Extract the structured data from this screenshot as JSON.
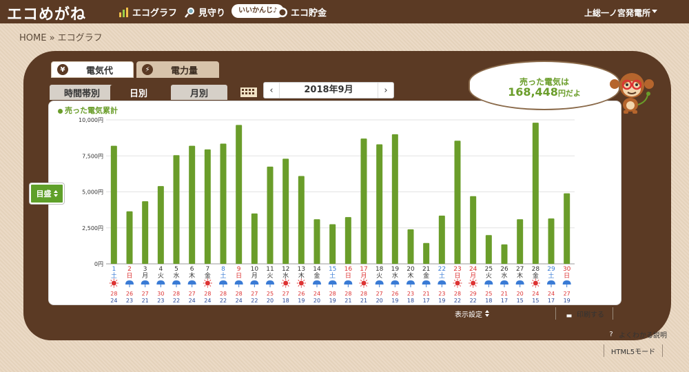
{
  "header": {
    "logo": "エコめがね",
    "nav": [
      {
        "label": "エコグラフ",
        "icon": "bar-chart-icon"
      },
      {
        "label": "見守り",
        "icon": "magnifier-icon"
      },
      {
        "label": "エコ貯金",
        "icon": "coin-icon"
      }
    ],
    "pill": "いいかんじ♪",
    "plant": "上総一ノ宮発電所"
  },
  "breadcrumb": "HOME » エコグラフ",
  "tabs": [
    {
      "label": "電気代",
      "icon": "yen-icon",
      "active": true
    },
    {
      "label": "電力量",
      "icon": "lightning-icon",
      "active": false
    }
  ],
  "subtabs": [
    {
      "label": "時間帯別",
      "active": false
    },
    {
      "label": "日別",
      "active": true
    },
    {
      "label": "月別",
      "active": false
    }
  ],
  "month_nav": {
    "prev": "‹",
    "label": "2018年9月",
    "next": "›"
  },
  "bubble": {
    "line1": "売った電気は",
    "amount": "168,448",
    "unit": "円だよ"
  },
  "target_button": "目盛",
  "footer": {
    "display_settings": "表示設定",
    "print": "印刷する",
    "help": "よくわかる説明",
    "html5": "HTML5モード"
  },
  "colors": {
    "accent_brown": "#5b3a24",
    "bar_green": "#6a9d2a",
    "saturday": "#3a7bd5",
    "holiday": "#d33",
    "high_temp": "#d33",
    "low_temp": "#2a4a9a"
  },
  "chart_data": {
    "type": "bar",
    "legend": "売った電気累計",
    "ylim": [
      0,
      10000
    ],
    "yticks": [
      "0円",
      "2,500円",
      "5,000円",
      "7,500円",
      "10,000円"
    ],
    "yvals": [
      0,
      2500,
      5000,
      7500,
      10000
    ],
    "categories": [
      "1",
      "2",
      "3",
      "4",
      "5",
      "6",
      "7",
      "8",
      "9",
      "10",
      "11",
      "12",
      "13",
      "14",
      "15",
      "16",
      "17",
      "18",
      "19",
      "20",
      "21",
      "22",
      "23",
      "24",
      "25",
      "26",
      "27",
      "28",
      "29",
      "30"
    ],
    "weekdays": [
      "土",
      "日",
      "月",
      "火",
      "水",
      "木",
      "金",
      "土",
      "日",
      "月",
      "火",
      "水",
      "木",
      "金",
      "土",
      "日",
      "月",
      "火",
      "水",
      "木",
      "金",
      "土",
      "日",
      "月",
      "火",
      "水",
      "木",
      "金",
      "土",
      "日"
    ],
    "day_kind": [
      "sat",
      "hol",
      "wk",
      "wk",
      "wk",
      "wk",
      "wk",
      "sat",
      "hol",
      "wk",
      "wk",
      "wk",
      "wk",
      "wk",
      "sat",
      "hol",
      "hol",
      "wk",
      "wk",
      "wk",
      "wk",
      "sat",
      "hol",
      "hol",
      "wk",
      "wk",
      "wk",
      "wk",
      "sat",
      "hol"
    ],
    "weather": [
      "sun",
      "rain",
      "rain",
      "rain",
      "rain",
      "rain",
      "sun",
      "rain",
      "rain",
      "rain",
      "rain",
      "sun",
      "sun",
      "rain",
      "rain",
      "rain",
      "sun",
      "rain",
      "rain",
      "rain",
      "rain",
      "rain",
      "sun",
      "sun",
      "rain",
      "rain",
      "rain",
      "sun",
      "rain",
      "rain"
    ],
    "high_temp": [
      "28",
      "26",
      "27",
      "30",
      "28",
      "27",
      "28",
      "28",
      "28",
      "27",
      "25",
      "27",
      "26",
      "24",
      "28",
      "28",
      "28",
      "27",
      "26",
      "23",
      "21",
      "23",
      "28",
      "29",
      "25",
      "21",
      "20",
      "24",
      "24",
      "27"
    ],
    "low_temp": [
      "24",
      "23",
      "21",
      "23",
      "22",
      "24",
      "24",
      "22",
      "24",
      "22",
      "20",
      "18",
      "19",
      "20",
      "19",
      "21",
      "21",
      "20",
      "19",
      "18",
      "17",
      "19",
      "22",
      "22",
      "18",
      "17",
      "15",
      "15",
      "17",
      "19"
    ],
    "values": [
      8200,
      3650,
      4350,
      5400,
      7550,
      8200,
      7950,
      8350,
      9650,
      3500,
      6750,
      7300,
      6100,
      3100,
      2750,
      3250,
      8700,
      8300,
      9000,
      2400,
      1450,
      3350,
      8550,
      4700,
      2000,
      1350,
      3100,
      9800,
      3150,
      4900
    ]
  }
}
